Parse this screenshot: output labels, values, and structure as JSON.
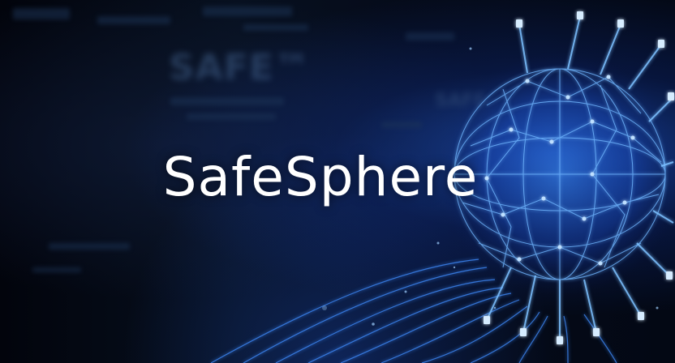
{
  "headline": "SafeSphere",
  "background_text": {
    "blurred_word_large": "SAFE™",
    "blurred_word_small": "SAFE"
  },
  "colors": {
    "accent_blue": "#2f7dff",
    "glow_blue": "#6fb6ff",
    "background": "#02050f",
    "headline": "#ffffff"
  }
}
